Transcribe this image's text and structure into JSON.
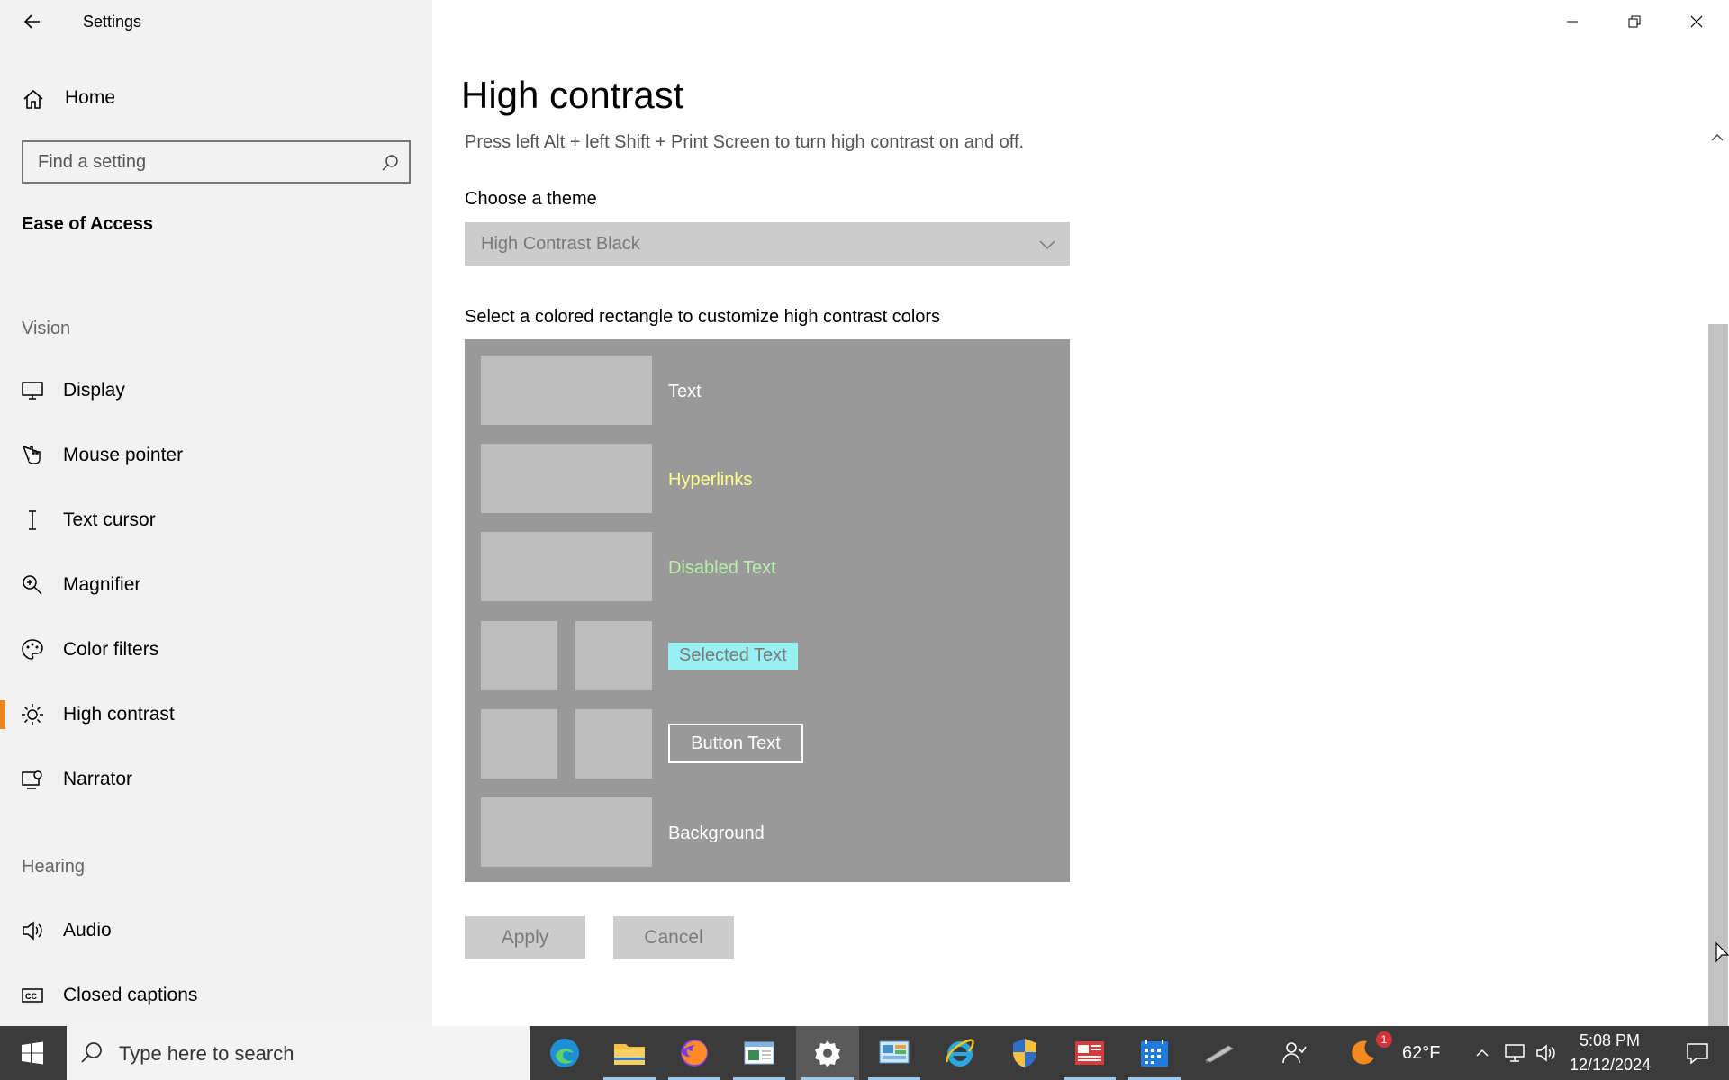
{
  "window": {
    "title": "Settings"
  },
  "sidebar": {
    "home_label": "Home",
    "search_placeholder": "Find a setting",
    "section_title": "Ease of Access",
    "group_vision": "Vision",
    "group_hearing": "Hearing",
    "items": [
      {
        "label": "Display",
        "icon": "display-icon"
      },
      {
        "label": "Mouse pointer",
        "icon": "mouse-pointer-icon"
      },
      {
        "label": "Text cursor",
        "icon": "text-cursor-icon"
      },
      {
        "label": "Magnifier",
        "icon": "magnifier-icon"
      },
      {
        "label": "Color filters",
        "icon": "color-filters-icon"
      },
      {
        "label": "High contrast",
        "icon": "high-contrast-icon",
        "active": true
      },
      {
        "label": "Narrator",
        "icon": "narrator-icon"
      },
      {
        "label": "Audio",
        "icon": "audio-icon"
      },
      {
        "label": "Closed captions",
        "icon": "closed-captions-icon"
      }
    ],
    "accent_color": "#e8861f"
  },
  "main": {
    "title": "High contrast",
    "hint": "Press left Alt + left Shift + Print Screen to turn high contrast on and off.",
    "choose_theme_label": "Choose a theme",
    "theme_value": "High Contrast Black",
    "customize_label": "Select a colored rectangle to customize high contrast colors",
    "color_rows": {
      "text": {
        "label": "Text",
        "color": "#ffffff"
      },
      "hyperlinks": {
        "label": "Hyperlinks",
        "color": "#ffff8a"
      },
      "disabled": {
        "label": "Disabled Text",
        "color": "#b6f0a6"
      },
      "selected": {
        "label": "Selected Text",
        "color": "#99f0f2"
      },
      "button": {
        "label": "Button Text",
        "color": "#ffffff"
      },
      "background": {
        "label": "Background",
        "color": "#ffffff"
      }
    },
    "apply_label": "Apply",
    "cancel_label": "Cancel"
  },
  "taskbar": {
    "search_placeholder": "Type here to search",
    "weather_temp": "62°F",
    "weather_badge": "1",
    "time": "5:08 PM",
    "date": "12/12/2024"
  }
}
